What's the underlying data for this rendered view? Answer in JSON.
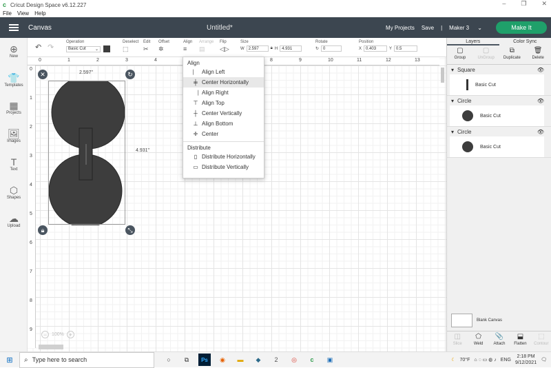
{
  "window": {
    "title": "Cricut Design Space  v6.12.227",
    "controls": [
      "–",
      "❐",
      "✕"
    ]
  },
  "menu": [
    "File",
    "View",
    "Help"
  ],
  "header": {
    "section": "Canvas",
    "doc_title": "Untitled*",
    "my_projects": "My Projects",
    "save": "Save",
    "sep": "|",
    "machine": "Maker 3",
    "make_it": "Make It"
  },
  "toolbar": {
    "operation_label": "Operation",
    "operation_value": "Basic Cut",
    "deselect_label": "Deselect",
    "edit_label": "Edit",
    "offset_label": "Offset",
    "align_label": "Align",
    "arrange_label": "Arrange",
    "flip_label": "Flip",
    "size_label": "Size",
    "w_label": "W",
    "w_value": "2.597",
    "h_label": "H",
    "h_value": "4.931",
    "rotate_label": "Rotate",
    "rotate_value": "0",
    "position_label": "Position",
    "x_label": "X",
    "x_value": "0.403",
    "y_label": "Y",
    "y_value": "0.5"
  },
  "left_rail": [
    {
      "label": "New",
      "icon": "plus-circle-icon",
      "glyph": "⊕"
    },
    {
      "label": "Templates",
      "icon": "shirt-icon",
      "glyph": "👕"
    },
    {
      "label": "Projects",
      "icon": "projects-icon",
      "glyph": "▦"
    },
    {
      "label": "Images",
      "icon": "image-icon",
      "glyph": "🖼"
    },
    {
      "label": "Text",
      "icon": "text-icon",
      "glyph": "T"
    },
    {
      "label": "Shapes",
      "icon": "shapes-icon",
      "glyph": "⬡"
    },
    {
      "label": "Upload",
      "icon": "upload-cloud-icon",
      "glyph": "☁"
    }
  ],
  "rulers": {
    "top": [
      "0",
      "1",
      "2",
      "3",
      "4",
      "5",
      "6",
      "7",
      "8",
      "9",
      "10",
      "11",
      "12",
      "13"
    ],
    "left": [
      "0",
      "1",
      "2",
      "3",
      "4",
      "5",
      "6",
      "7",
      "8",
      "9"
    ]
  },
  "selection": {
    "width_label": "2.597\"",
    "height_label": "4.931\""
  },
  "zoom": {
    "minus": "−",
    "value": "100%",
    "plus": "+"
  },
  "align_menu": {
    "heading": "Align",
    "items": [
      {
        "label": "Align Left",
        "icon": "align-left-icon",
        "glyph": "⎸"
      },
      {
        "label": "Center Horizontally",
        "icon": "center-horizontally-icon",
        "glyph": "╪"
      },
      {
        "label": "Align Right",
        "icon": "align-right-icon",
        "glyph": "⎹"
      },
      {
        "label": "Align Top",
        "icon": "align-top-icon",
        "glyph": "⊤"
      },
      {
        "label": "Center Vertically",
        "icon": "center-vertically-icon",
        "glyph": "┼"
      },
      {
        "label": "Align Bottom",
        "icon": "align-bottom-icon",
        "glyph": "⊥"
      },
      {
        "label": "Center",
        "icon": "center-icon",
        "glyph": "✛"
      }
    ],
    "distribute_heading": "Distribute",
    "distribute_items": [
      {
        "label": "Distribute Horizontally",
        "icon": "distribute-horizontally-icon",
        "glyph": "▯"
      },
      {
        "label": "Distribute Vertically",
        "icon": "distribute-vertically-icon",
        "glyph": "▭"
      }
    ]
  },
  "right_panel": {
    "tabs": [
      "Layers",
      "Color Sync"
    ],
    "actions": [
      {
        "label": "Group",
        "disabled": false,
        "glyph": "▢"
      },
      {
        "label": "UnGroup",
        "disabled": true,
        "glyph": "▢"
      },
      {
        "label": "Duplicate",
        "disabled": false,
        "glyph": "⧉"
      },
      {
        "label": "Delete",
        "disabled": false,
        "glyph": "🗑"
      }
    ],
    "layers": [
      {
        "name": "Square",
        "op": "Basic Cut",
        "shape": "square"
      },
      {
        "name": "Circle",
        "op": "Basic Cut",
        "shape": "circle"
      },
      {
        "name": "Circle",
        "op": "Basic Cut",
        "shape": "circle"
      }
    ],
    "blank_canvas": "Blank Canvas",
    "bottom_actions": [
      {
        "label": "Slice",
        "disabled": true,
        "glyph": "◫"
      },
      {
        "label": "Weld",
        "disabled": false,
        "glyph": "⬠"
      },
      {
        "label": "Attach",
        "disabled": false,
        "glyph": "📎"
      },
      {
        "label": "Flatten",
        "disabled": false,
        "glyph": "⬓"
      },
      {
        "label": "Contour",
        "disabled": true,
        "glyph": "⬚"
      }
    ]
  },
  "taskbar": {
    "search_placeholder": "Type here to search",
    "weather": "70°F",
    "lang": "ENG",
    "time": "2:18 PM",
    "date": "9/12/2021",
    "notif_count": "2"
  },
  "colors": {
    "header_bg": "#3c4650",
    "make_it": "#1fa06a",
    "shape_fill": "#3d3d3d"
  }
}
